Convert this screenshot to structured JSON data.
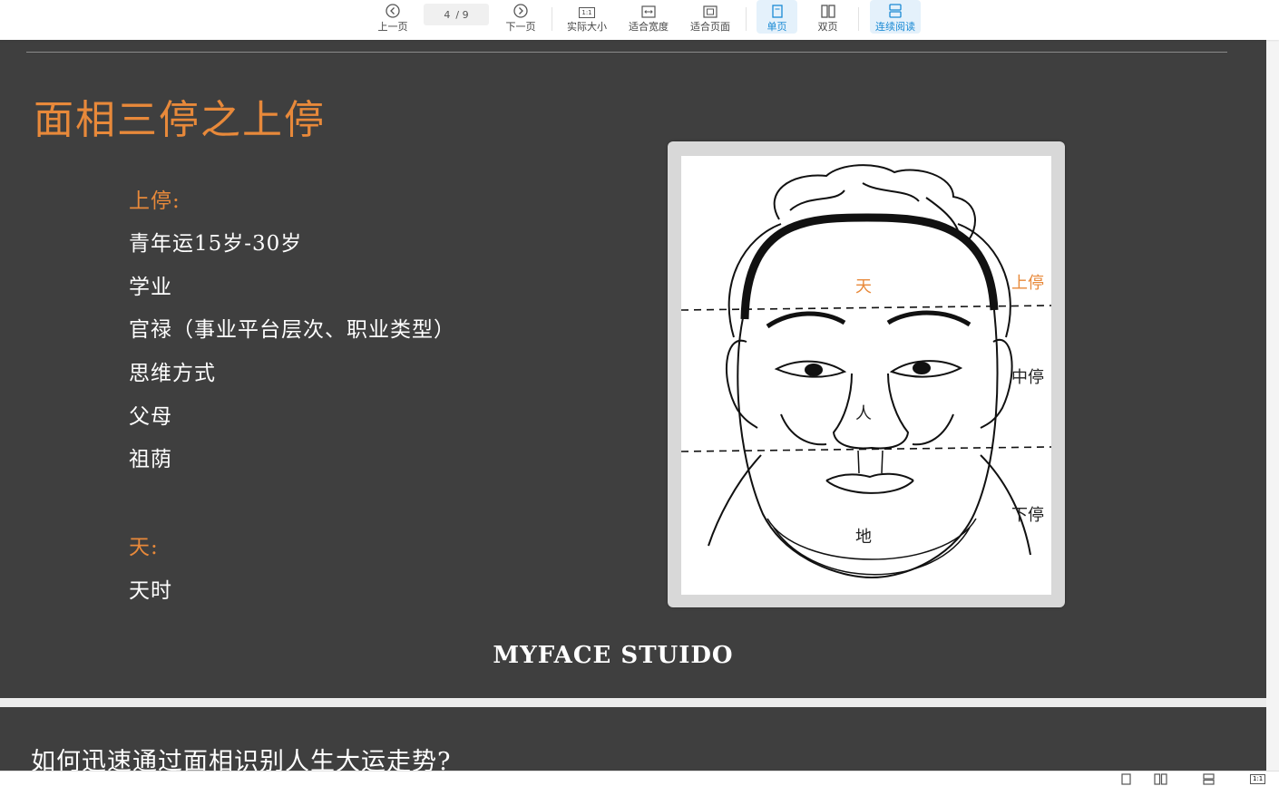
{
  "toolbar": {
    "prev": "上一页",
    "page_current": "4",
    "page_total": "/ 9",
    "next": "下一页",
    "actual_size": "实际大小",
    "actual_size_icon_text": "1:1",
    "fit_width": "适合宽度",
    "fit_page": "适合页面",
    "single_page": "单页",
    "double_page": "双页",
    "continuous": "连续阅读",
    "accent": "#1a8ad4"
  },
  "slide": {
    "title": "面相三停之上停",
    "sections": [
      {
        "heading": "上停:",
        "items": [
          "青年运15岁-30岁",
          "学业",
          "官禄（事业平台层次、职业类型）",
          "思维方式",
          "父母",
          "祖荫"
        ]
      },
      {
        "heading": "天:",
        "items": [
          "天时"
        ]
      }
    ],
    "face_labels": {
      "tian": "天",
      "ren": "人",
      "di": "地",
      "upper": "上停",
      "middle": "中停",
      "lower": "下停"
    },
    "footer": "MYFACE STUIDO",
    "title_color": "#e8893a",
    "background": "#3f3f3f"
  },
  "next_slide": {
    "title": "如何迅速通过面相识别人生大运走势?"
  },
  "statusbar": {
    "actual_size_icon_text": "1:1"
  }
}
